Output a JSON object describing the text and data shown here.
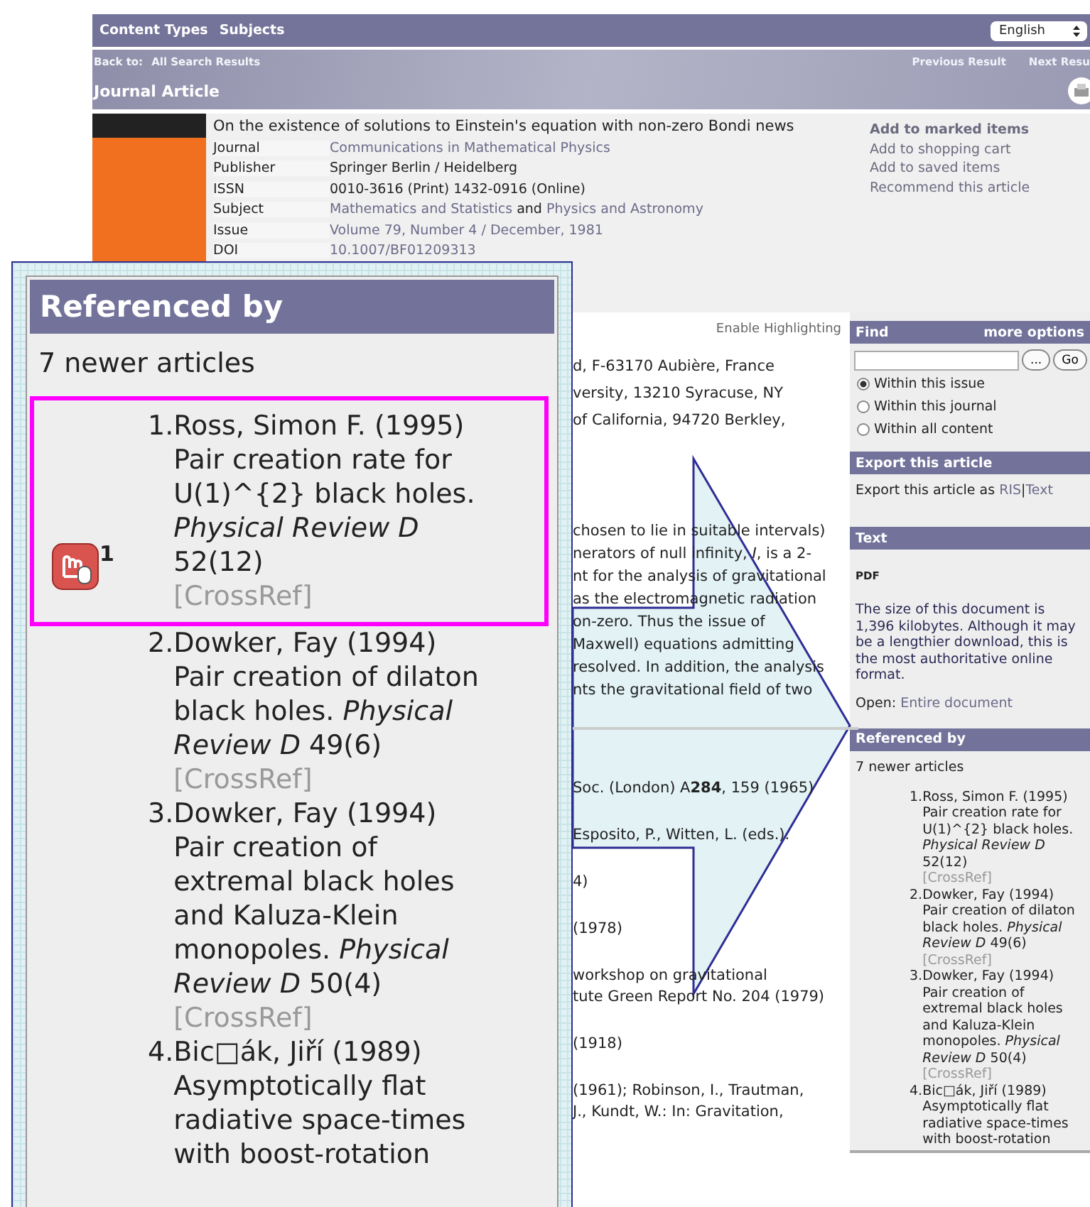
{
  "nav": {
    "links": [
      "Content Types",
      "Subjects"
    ],
    "language": "English"
  },
  "banner": {
    "back_label": "Back to:",
    "back_link": "All Search Results",
    "pager": [
      "Previous Result",
      "Next Resu"
    ],
    "title": "Journal Article"
  },
  "article": {
    "title": "On the existence of solutions to Einstein's equation with non-zero Bondi news",
    "fields": [
      {
        "label": "Journal",
        "parts": [
          {
            "text": "Communications in Mathematical Physics",
            "kind": "link"
          }
        ]
      },
      {
        "label": "Publisher",
        "parts": [
          {
            "text": "Springer Berlin / Heidelberg",
            "kind": "plain"
          }
        ]
      },
      {
        "label": "ISSN",
        "parts": [
          {
            "text": "0010-3616 (Print) 1432-0916 (Online)",
            "kind": "plain"
          }
        ]
      },
      {
        "label": "Subject",
        "parts": [
          {
            "text": "Mathematics and Statistics",
            "kind": "link"
          },
          {
            "text": "and",
            "kind": "plain"
          },
          {
            "text": "Physics and Astronomy",
            "kind": "link"
          }
        ]
      },
      {
        "label": "Issue",
        "parts": [
          {
            "text": "Volume 79, Number 4 / December, 1981",
            "kind": "link"
          }
        ]
      },
      {
        "label": "DOI",
        "parts": [
          {
            "text": "10.1007/BF01209313",
            "kind": "link"
          }
        ]
      }
    ],
    "actions": [
      {
        "label": "Add to marked items",
        "bold": true
      },
      {
        "label": "Add to shopping cart",
        "bold": false
      },
      {
        "label": "Add to saved items",
        "bold": false
      },
      {
        "label": "Recommend this article",
        "bold": false
      }
    ]
  },
  "content": {
    "enable_highlighting": "Enable Highlighting",
    "affiliations": [
      "d, F-63170 Aubière, France",
      "versity, 13210 Syracuse, NY",
      "of California, 94720 Berkley,"
    ],
    "abstract_lines": [
      "chosen to lie in suitable intervals)",
      "nerators of null infinity, *I*, is a 2-",
      "nt for the analysis of gravitational",
      "as the electromagnetic radiation",
      "on-zero. Thus the issue of",
      "Maxwell) equations admitting",
      "resolved. In addition, the analysis",
      "nts the gravitational field of two"
    ],
    "references": [
      [
        "Soc. (London) A**284**, 159 (1965)"
      ],
      [
        "Esposito, P., Witten, L. (eds.)."
      ],
      [
        "4)"
      ],
      [
        "(1978)"
      ],
      [
        "workshop on gravitational",
        "tute Green Report No. 204 (1979)"
      ],
      [
        "(1918)"
      ],
      [
        "(1961); Robinson, I., Trautman,",
        "J., Kundt, W.: In: Gravitation,"
      ]
    ]
  },
  "sidebar": {
    "find": {
      "title": "Find",
      "more": "more options",
      "browse_button": "...",
      "go_button": "Go",
      "scopes": [
        {
          "label": "Within this issue",
          "selected": true
        },
        {
          "label": "Within this journal",
          "selected": false
        },
        {
          "label": "Within all content",
          "selected": false
        }
      ]
    },
    "export": {
      "title": "Export this article",
      "text": "Export this article as",
      "links": [
        "RIS",
        "Text"
      ],
      "separator": "|"
    },
    "text_section": {
      "title": "Text",
      "format": "PDF",
      "description": "The size of this document is 1,396 kilobytes. Although it may be a lengthier download, this is the most authoritative online format.",
      "open_label": "Open:",
      "open_link": "Entire document"
    },
    "referenced_by": {
      "title": "Referenced by",
      "count": "7 newer articles",
      "items": [
        {
          "number": "1.",
          "text": "Ross, Simon F. (1995) Pair creation rate for U(1)^{2} black holes. *Physical Review D* 52(12)",
          "link": "[CrossRef]"
        },
        {
          "number": "2.",
          "text": "Dowker, Fay (1994) Pair creation of dilaton black holes. *Physical Review D* 49(6)",
          "link": "[CrossRef]"
        },
        {
          "number": "3.",
          "text": "Dowker, Fay (1994) Pair creation of extremal black holes and Kaluza-Klein monopoles. *Physical Review D* 50(4)",
          "link": "[CrossRef]"
        },
        {
          "number": "4.",
          "text": "Bic□ák, Jiří (1989) Asymptotically flat radiative space-times with boost-rotation"
        }
      ]
    }
  },
  "magnifier": {
    "title": "Referenced by",
    "count": "7 newer articles",
    "items": [
      {
        "number": "1.",
        "text": "Ross, Simon F. (1995) Pair creation rate for U(1)^{2} black holes. *Physical Review D* 52(12)",
        "link": "[CrossRef]",
        "highlighted": true,
        "badge": "1"
      },
      {
        "number": "2.",
        "text": "Dowker, Fay (1994) Pair creation of dilaton black holes. *Physical Review D* 49(6)",
        "link": "[CrossRef]",
        "highlighted": false
      },
      {
        "number": "3.",
        "text": "Dowker, Fay (1994) Pair creation of extremal black holes and Kaluza-Klein monopoles. *Physical Review D* 50(4)",
        "link": "[CrossRef]",
        "highlighted": false
      },
      {
        "number": "4.",
        "text": "Bic□ák, Jiří (1989) Asymptotically flat radiative space-times with boost-rotation",
        "highlighted": false
      }
    ]
  }
}
